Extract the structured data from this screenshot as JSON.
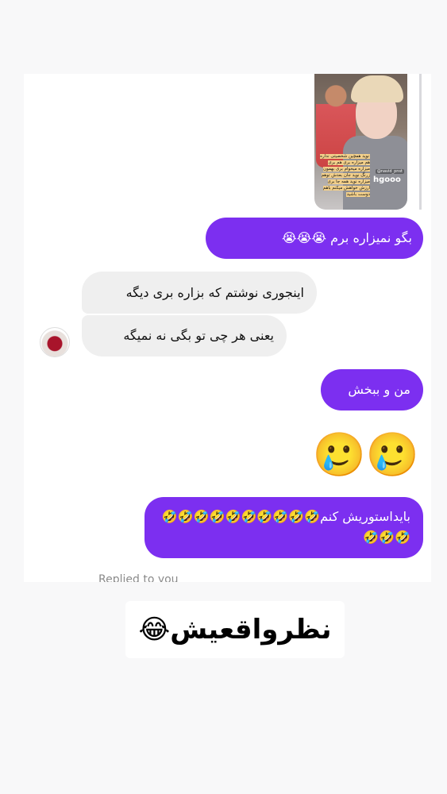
{
  "story": {
    "caption": "نوید همچین شخصیتی نداره هم میزاره بری هم بری میزاره میخوام بری بهمون زرنگ نوید جان بعدش توهم میزاره نوید همه جا بری ارزش خواهش میکنم باهم دوست باشید",
    "username_tag": "@navid_pnst",
    "overlay_word": "hgooo"
  },
  "messages": [
    {
      "id": "m1",
      "direction": "out",
      "text": "بگو نمیزاره برم 😭😭😭"
    },
    {
      "id": "m2",
      "direction": "in",
      "text": "اینجوری نوشتم که بزاره بری دیگه"
    },
    {
      "id": "m3",
      "direction": "in",
      "text": "یعنی هر چی تو بگی نه نمیگه"
    },
    {
      "id": "m4",
      "direction": "out",
      "text": "من و ببخش"
    },
    {
      "id": "m5",
      "direction": "out",
      "text": "🥲🥲",
      "emoji_only": true
    },
    {
      "id": "m6",
      "direction": "out",
      "text": "بایداستوریش کنم🤣🤣🤣🤣🤣🤣🤣🤣🤣🤣🤣🤣🤣"
    }
  ],
  "reply_indicator": "Replied to you",
  "caption_overlay": "نظرواقعیش😂",
  "colors": {
    "outgoing_bubble": "#7c2ff0",
    "incoming_bubble": "#efefef",
    "page_background": "#f8f8f9"
  }
}
